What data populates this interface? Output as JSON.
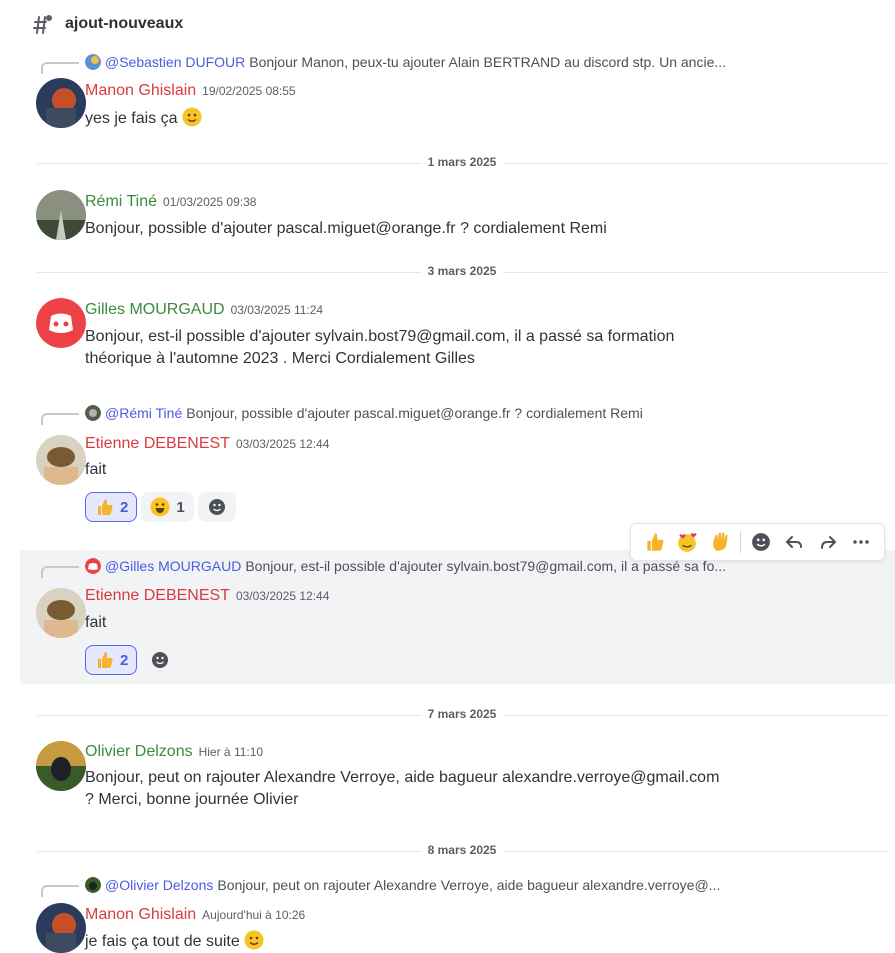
{
  "channel": {
    "name": "ajout-nouveaux"
  },
  "messages": [
    {
      "reply_to": {
        "mention": "@Sebastien DUFOUR",
        "text": "Bonjour Manon, peux-tu ajouter Alain BERTRAND au discord stp. Un ancie..."
      },
      "author": "Manon Ghislain",
      "timestamp": "19/02/2025 08:55",
      "text": "yes je fais ça"
    },
    {
      "author": "Rémi Tiné",
      "timestamp": "01/03/2025 09:38",
      "text": "Bonjour, possible d'ajouter pascal.miguet@orange.fr ? cordialement Remi"
    },
    {
      "author": "Gilles MOURGAUD",
      "timestamp": "03/03/2025 11:24",
      "text_line1": "Bonjour, est-il possible d'ajouter sylvain.bost79@gmail.com, il a passé sa formation",
      "text_line2": "théorique à l'automne 2023 . Merci  Cordialement Gilles"
    },
    {
      "reply_to": {
        "mention": "@Rémi Tiné",
        "text": "Bonjour, possible d'ajouter pascal.miguet@orange.fr ? cordialement Remi"
      },
      "author": "Etienne DEBENEST",
      "timestamp": "03/03/2025 12:44",
      "text": "fait",
      "reactions": [
        {
          "emoji": "thumbs-up",
          "count": "2"
        },
        {
          "emoji": "grinning",
          "count": "1"
        }
      ]
    },
    {
      "reply_to": {
        "mention": "@Gilles MOURGAUD",
        "text": "Bonjour, est-il possible d'ajouter sylvain.bost79@gmail.com, il a passé sa fo..."
      },
      "author": "Etienne DEBENEST",
      "timestamp": "03/03/2025 12:44",
      "text": "fait",
      "reactions": [
        {
          "emoji": "thumbs-up",
          "count": "2"
        }
      ]
    },
    {
      "author": "Olivier Delzons",
      "timestamp": "Hier à 11:10",
      "text_line1": "Bonjour, peut on rajouter Alexandre Verroye, aide bagueur alexandre.verroye@gmail.com",
      "text_line2": "? Merci, bonne journée Olivier"
    },
    {
      "reply_to": {
        "mention": "@Olivier Delzons",
        "text": "Bonjour, peut on rajouter Alexandre Verroye, aide bagueur alexandre.verroye@..."
      },
      "author": "Manon Ghislain",
      "timestamp": "Aujourd'hui à 10:26",
      "text": "je fais ça tout de suite"
    }
  ],
  "dividers": [
    "1 mars 2025",
    "3 mars 2025",
    "7 mars 2025",
    "8 mars 2025"
  ],
  "colors": {
    "accent": "#5865f2",
    "red_name": "#d83c3e",
    "green_name": "#3c8b3c",
    "hover_bg": "#f2f3f5"
  },
  "toolbar": {
    "icons": [
      "thumbs-up-icon",
      "smiling-hearts-icon",
      "waving-hand-icon",
      "add-reaction-icon",
      "reply-icon",
      "forward-icon",
      "more-icon"
    ]
  }
}
